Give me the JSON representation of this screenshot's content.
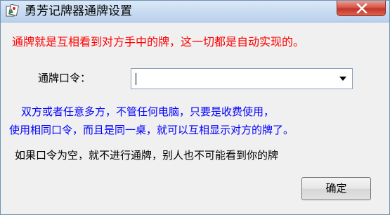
{
  "window": {
    "title": "勇芳记牌器通牌设置",
    "close_symbol": "✕"
  },
  "notice": {
    "red": "通牌就是互相看到对方手中的牌，这一切都是自动实现的。",
    "blue_line_1": "双方或者任意多方，不管任何电脑，只要是收费使用，",
    "blue_line_2": "使用相同口令，而且是同一桌，就可以互相显示对方的牌了。",
    "black": "如果口令为空，就不进行通牌，别人也不可能看到你的牌"
  },
  "form": {
    "password_label": "通牌口令：",
    "password_value": ""
  },
  "buttons": {
    "ok_label": "确定"
  },
  "colors": {
    "notice_red": "#ff0000",
    "notice_blue": "#0000ff",
    "close_button": "#c4352a"
  },
  "icons": {
    "app": "card-app-icon",
    "close": "close-icon",
    "dropdown": "chevron-down-icon"
  }
}
